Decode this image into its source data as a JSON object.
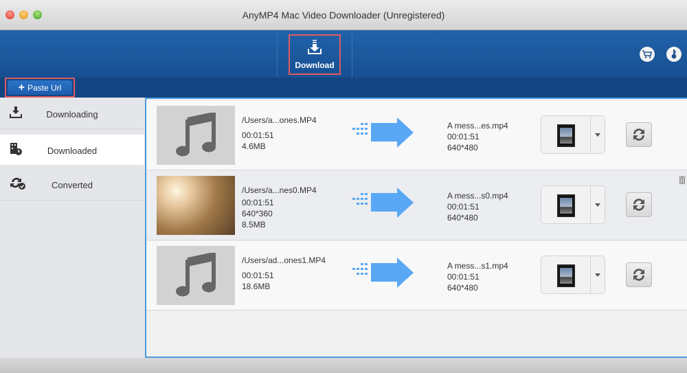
{
  "window": {
    "title": "AnyMP4 Mac Video Downloader (Unregistered)"
  },
  "toolbar": {
    "download_label": "Download",
    "cart_icon": "cart-icon",
    "register_icon": "key-icon"
  },
  "subbar": {
    "paste_url_label": "Paste Url"
  },
  "sidebar": {
    "items": [
      {
        "label": "Downloading",
        "icon": "download-icon"
      },
      {
        "label": "Downloaded",
        "icon": "film-clock-icon",
        "active": true
      },
      {
        "label": "Converted",
        "icon": "convert-check-icon"
      }
    ]
  },
  "rows": [
    {
      "thumb": "music-note",
      "source": "/Users/a...ones.MP4",
      "lines": [
        "00:01:51",
        "4.6MB"
      ],
      "output": [
        "A mess...es.mp4",
        "00:01:51",
        "640*480"
      ]
    },
    {
      "thumb": "video-frame",
      "source": "/Users/a...nes0.MP4",
      "lines": [
        "00:01:51",
        "640*360",
        "8.5MB"
      ],
      "output": [
        "A mess...s0.mp4",
        "00:01:51",
        "640*480"
      ]
    },
    {
      "thumb": "music-note",
      "source": "/Users/ad...ones1.MP4",
      "lines": [
        "00:01:51",
        "18.6MB"
      ],
      "output": [
        "A mess...s1.mp4",
        "00:01:51",
        "640*480"
      ]
    }
  ],
  "colors": {
    "toolbar": "#1e5ea5",
    "highlight": "#e05a5f",
    "arrow": "#5aa8f5",
    "selection_border": "#4a9be0"
  }
}
